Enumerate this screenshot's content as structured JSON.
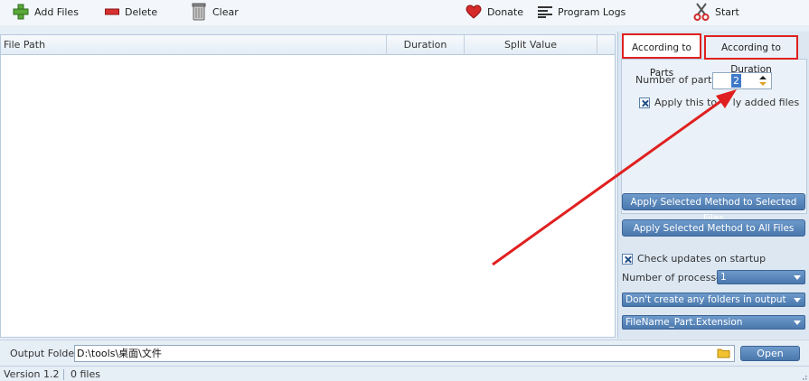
{
  "toolbar": {
    "add_files": "Add Files",
    "delete": "Delete",
    "clear": "Clear",
    "donate": "Donate",
    "program_logs": "Program Logs",
    "start": "Start"
  },
  "table": {
    "columns": [
      "File Path",
      "Duration",
      "Split Value"
    ]
  },
  "tabs": {
    "parts": "According to Parts",
    "duration": "According to Duration"
  },
  "parts_panel": {
    "number_label": "Number of parts:",
    "number_value": "2",
    "apply_prefix": "Apply this to ",
    "apply_suffix": "ly added files"
  },
  "buttons": {
    "apply_selected": "Apply Selected Method to Selected Files",
    "apply_all": "Apply Selected Method to All Files",
    "open": "Open"
  },
  "options": {
    "check_updates": "Check updates on startup",
    "processes_label": "Number of processes:",
    "processes_value": "1",
    "folder_option": "Don't create any folders in output",
    "name_pattern": "FileName_Part.Extension"
  },
  "output": {
    "label": "Output Folder:",
    "path": "D:\\tools\\桌面\\文件"
  },
  "status": {
    "version": "Version 1.2",
    "files": "0 files"
  },
  "colors": {
    "annotation_red": "#e02020",
    "button_blue": "#4a78ad"
  }
}
